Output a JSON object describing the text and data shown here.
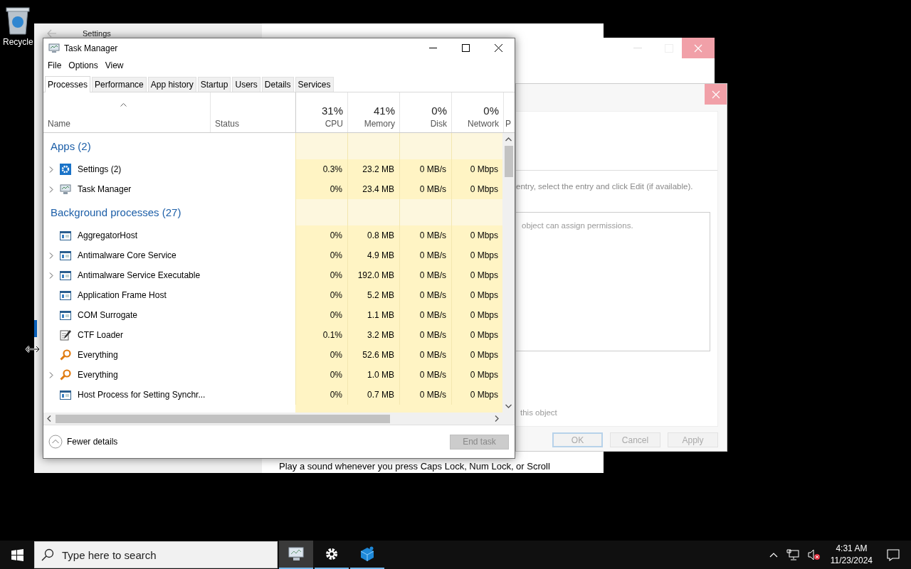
{
  "desktop_icons": [
    {
      "label": "Recycle"
    }
  ],
  "settings_window": {
    "title": "Settings",
    "footer_text": "Play a sound whenever you press Caps Lock, Num Lock, or Scroll"
  },
  "permissions_dialog": {
    "instruction": "entry, select the entry and click Edit (if available).",
    "list_text": "object can assign permissions.",
    "footer_text": "this object",
    "buttons": [
      {
        "label": "OK",
        "default": true
      },
      {
        "label": "Cancel",
        "default": false
      },
      {
        "label": "Apply",
        "default": false
      }
    ]
  },
  "task_manager": {
    "title": "Task Manager",
    "menu": [
      "File",
      "Options",
      "View"
    ],
    "tabs": [
      {
        "label": "Processes",
        "selected": true
      },
      {
        "label": "Performance",
        "selected": false
      },
      {
        "label": "App history",
        "selected": false
      },
      {
        "label": "Startup",
        "selected": false
      },
      {
        "label": "Users",
        "selected": false
      },
      {
        "label": "Details",
        "selected": false
      },
      {
        "label": "Services",
        "selected": false
      }
    ],
    "columns": [
      {
        "label": "Name"
      },
      {
        "label": "Status"
      },
      {
        "usage": "31%",
        "label": "CPU"
      },
      {
        "usage": "41%",
        "label": "Memory"
      },
      {
        "usage": "0%",
        "label": "Disk"
      },
      {
        "usage": "0%",
        "label": "Network"
      },
      {
        "label": "P"
      }
    ],
    "groups": [
      {
        "title": "Apps (2)",
        "rows": [
          {
            "name": "Settings (2)",
            "kind": "gear",
            "expandable": true,
            "cpu": "0.3%",
            "memory": "23.2 MB",
            "disk": "0 MB/s",
            "network": "0 Mbps"
          },
          {
            "name": "Task Manager",
            "kind": "monitor",
            "expandable": true,
            "cpu": "0%",
            "memory": "23.4 MB",
            "disk": "0 MB/s",
            "network": "0 Mbps"
          }
        ]
      },
      {
        "title": "Background processes (27)",
        "rows": [
          {
            "name": "AggregatorHost",
            "kind": "window",
            "expandable": false,
            "cpu": "0%",
            "memory": "0.8 MB",
            "disk": "0 MB/s",
            "network": "0 Mbps"
          },
          {
            "name": "Antimalware Core Service",
            "kind": "window",
            "expandable": true,
            "cpu": "0%",
            "memory": "4.9 MB",
            "disk": "0 MB/s",
            "network": "0 Mbps"
          },
          {
            "name": "Antimalware Service Executable",
            "kind": "window",
            "expandable": true,
            "cpu": "0%",
            "memory": "192.0 MB",
            "disk": "0 MB/s",
            "network": "0 Mbps"
          },
          {
            "name": "Application Frame Host",
            "kind": "window",
            "expandable": false,
            "cpu": "0%",
            "memory": "5.2 MB",
            "disk": "0 MB/s",
            "network": "0 Mbps"
          },
          {
            "name": "COM Surrogate",
            "kind": "window",
            "expandable": false,
            "cpu": "0%",
            "memory": "1.1 MB",
            "disk": "0 MB/s",
            "network": "0 Mbps"
          },
          {
            "name": "CTF Loader",
            "kind": "pen",
            "expandable": false,
            "cpu": "0.1%",
            "memory": "3.2 MB",
            "disk": "0 MB/s",
            "network": "0 Mbps"
          },
          {
            "name": "Everything",
            "kind": "magnifier",
            "expandable": false,
            "cpu": "0%",
            "memory": "52.6 MB",
            "disk": "0 MB/s",
            "network": "0 Mbps"
          },
          {
            "name": "Everything",
            "kind": "magnifier",
            "expandable": true,
            "cpu": "0%",
            "memory": "1.0 MB",
            "disk": "0 MB/s",
            "network": "0 Mbps"
          },
          {
            "name": "Host Process for Setting Synchr...",
            "kind": "window",
            "expandable": false,
            "cpu": "0%",
            "memory": "0.7 MB",
            "disk": "0 MB/s",
            "network": "0 Mbps"
          }
        ]
      }
    ],
    "fewer_details": "Fewer details",
    "end_task": {
      "label": "End task",
      "disabled": true
    }
  },
  "taskbar": {
    "search": {
      "placeholder": "Type here to search"
    },
    "apps": [
      {
        "kind": "monitor",
        "selected": true
      },
      {
        "kind": "gear",
        "selected": false
      },
      {
        "kind": "cube",
        "selected": false
      }
    ],
    "time": "4:31 AM",
    "date": "11/23/2024"
  }
}
